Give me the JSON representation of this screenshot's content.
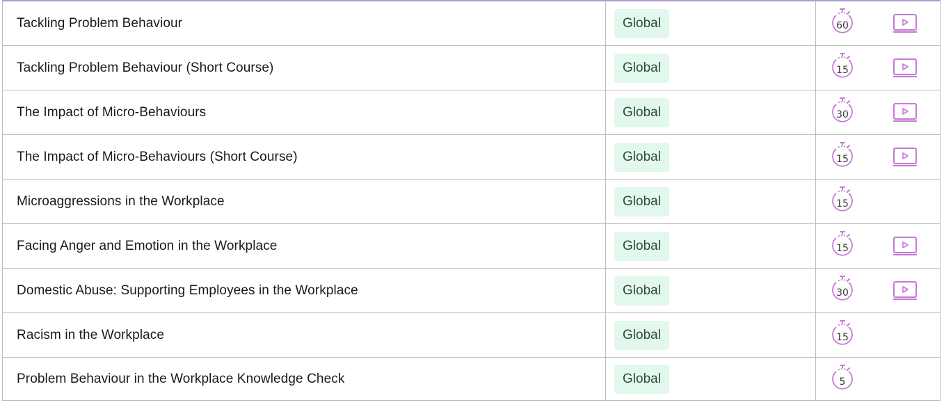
{
  "table": {
    "rows": [
      {
        "title": "Tackling Problem Behaviour",
        "region": "Global",
        "duration": "60",
        "has_video": true
      },
      {
        "title": "Tackling Problem Behaviour (Short Course)",
        "region": "Global",
        "duration": "15",
        "has_video": true
      },
      {
        "title": "The Impact of Micro-Behaviours",
        "region": "Global",
        "duration": "30",
        "has_video": true
      },
      {
        "title": "The Impact of Micro-Behaviours (Short Course)",
        "region": "Global",
        "duration": "15",
        "has_video": true
      },
      {
        "title": "Microaggressions in the Workplace",
        "region": "Global",
        "duration": "15",
        "has_video": false
      },
      {
        "title": "Facing Anger and Emotion in the Workplace",
        "region": "Global",
        "duration": "15",
        "has_video": true
      },
      {
        "title": "Domestic Abuse: Supporting Employees in the Workplace",
        "region": "Global",
        "duration": "30",
        "has_video": true
      },
      {
        "title": "Racism in the Workplace",
        "region": "Global",
        "duration": "15",
        "has_video": false
      },
      {
        "title": "Problem Behaviour in the Workplace Knowledge Check",
        "region": "Global",
        "duration": "5",
        "has_video": false
      }
    ]
  },
  "icons": {
    "timer": "stopwatch-icon",
    "video": "video-play-icon"
  },
  "colors": {
    "accent_purple": "#c77ad6",
    "badge_bg": "#e2f8ec",
    "border": "#bdbdbd",
    "top_border": "#a99bd0"
  }
}
